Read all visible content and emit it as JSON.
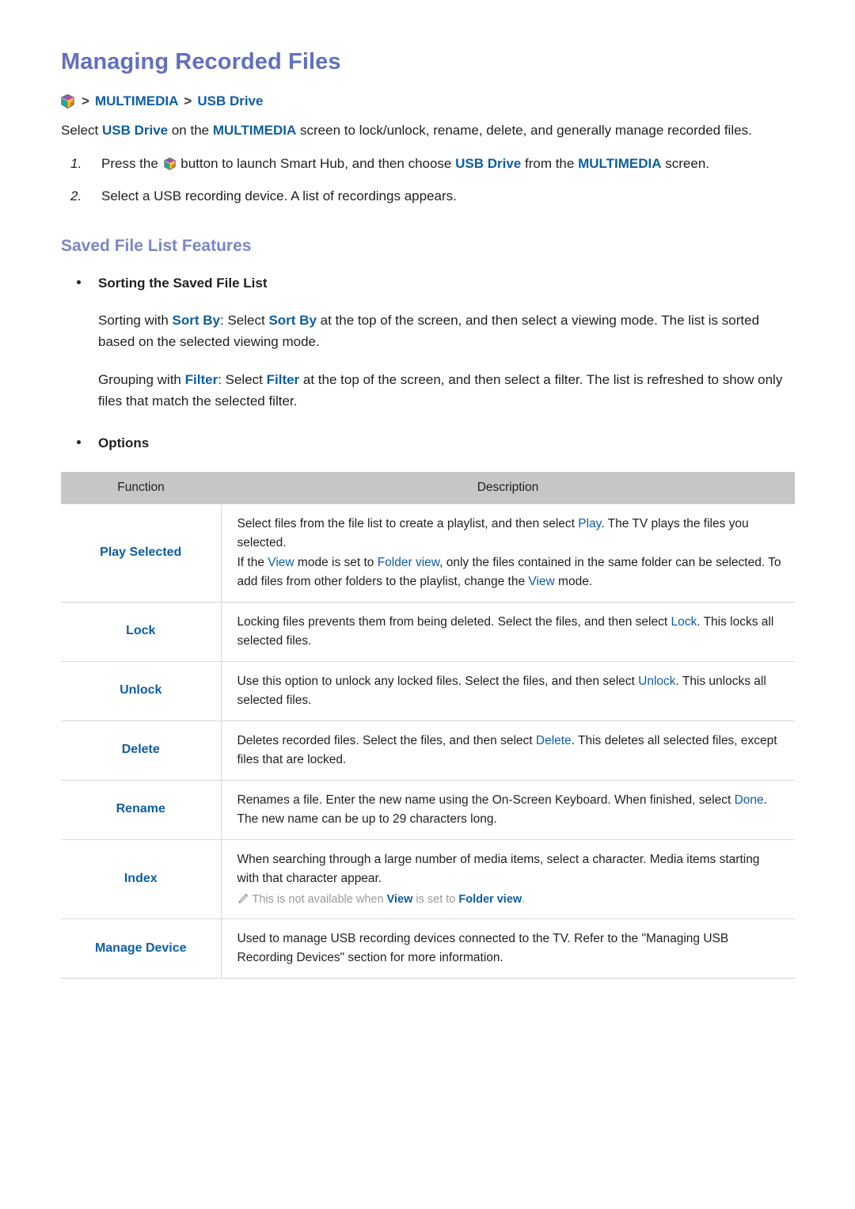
{
  "page": {
    "title": "Managing Recorded Files"
  },
  "breadcrumb": {
    "icon": "smart-hub-icon",
    "separator": ">",
    "items": [
      "MULTIMEDIA",
      "USB Drive"
    ]
  },
  "intro": {
    "prefix": "Select ",
    "link1": "USB Drive",
    "mid": " on the ",
    "link2": "MULTIMEDIA",
    "suffix": " screen to lock/unlock, rename, delete, and generally manage recorded files."
  },
  "steps": [
    {
      "num": "1.",
      "part1": "Press the ",
      "icon": "smart-hub-icon",
      "part2": " button to launch Smart Hub, and then choose ",
      "link1": "USB Drive",
      "part3": " from the ",
      "link2": "MULTIMEDIA",
      "part4": " screen."
    },
    {
      "num": "2.",
      "part1": "Select a USB recording device. A list of recordings appears.",
      "icon": "",
      "part2": "",
      "link1": "",
      "part3": "",
      "link2": "",
      "part4": ""
    }
  ],
  "section": {
    "title": "Saved File List Features",
    "bullet1": {
      "label": "Sorting the Saved File List",
      "para1": {
        "a": "Sorting with ",
        "link1": "Sort By",
        "b": ": Select ",
        "link2": "Sort By",
        "c": " at the top of the screen, and then select a viewing mode. The list is sorted based on the selected viewing mode."
      },
      "para2": {
        "a": "Grouping with ",
        "link1": "Filter",
        "b": ": Select ",
        "link2": "Filter",
        "c": " at the top of the screen, and then select a filter. The list is refreshed to show only files that match the selected filter."
      }
    },
    "bullet2": {
      "label": "Options"
    }
  },
  "table": {
    "headers": {
      "function": "Function",
      "description": "Description"
    },
    "rows": [
      {
        "function": "Play Selected",
        "line1": {
          "a": "Select files from the file list to create a playlist, and then select ",
          "l1": "Play",
          "b": ". The TV plays the files you selected.",
          "l2": "",
          "c": "",
          "l3": "",
          "d": ""
        },
        "line2": {
          "a": "If the ",
          "l1": "View",
          "b": " mode is set to ",
          "l2": "Folder view",
          "c": ", only the files contained in the same folder can be selected. To add files from other folders to the playlist, change the ",
          "l3": "View",
          "d": " mode."
        },
        "note": null
      },
      {
        "function": "Lock",
        "line1": {
          "a": "Locking files prevents them from being deleted. Select the files, and then select ",
          "l1": "Lock",
          "b": ". This locks all selected files.",
          "l2": "",
          "c": "",
          "l3": "",
          "d": ""
        },
        "line2": null,
        "note": null
      },
      {
        "function": "Unlock",
        "line1": {
          "a": "Use this option to unlock any locked files. Select the files, and then select ",
          "l1": "Unlock",
          "b": ". This unlocks all selected files.",
          "l2": "",
          "c": "",
          "l3": "",
          "d": ""
        },
        "line2": null,
        "note": null
      },
      {
        "function": "Delete",
        "line1": {
          "a": "Deletes recorded files. Select the files, and then select ",
          "l1": "Delete",
          "b": ". This deletes all selected files, except files that are locked.",
          "l2": "",
          "c": "",
          "l3": "",
          "d": ""
        },
        "line2": null,
        "note": null
      },
      {
        "function": "Rename",
        "line1": {
          "a": "Renames a file. Enter the new name using the On-Screen Keyboard. When finished, select ",
          "l1": "Done",
          "b": ". The new name can be up to 29 characters long.",
          "l2": "",
          "c": "",
          "l3": "",
          "d": ""
        },
        "line2": null,
        "note": null
      },
      {
        "function": "Index",
        "line1": {
          "a": "When searching through a large number of media items, select a character. Media items starting with that character appear.",
          "l1": "",
          "b": "",
          "l2": "",
          "c": "",
          "l3": "",
          "d": ""
        },
        "line2": null,
        "note": {
          "icon": "pencil-icon",
          "a": "This is not available when ",
          "l1": "View",
          "b": " is set to ",
          "l2": "Folder view",
          "c": "."
        }
      },
      {
        "function": "Manage Device",
        "line1": {
          "a": "Used to manage USB recording devices connected to the TV. Refer to the \"Managing USB Recording Devices\" section for more information.",
          "l1": "",
          "b": "",
          "l2": "",
          "c": "",
          "l3": "",
          "d": ""
        },
        "line2": null,
        "note": null
      }
    ]
  },
  "colors": {
    "title_purple": "#6370bd",
    "section_purple": "#7b86c9",
    "link_blue": "#0d5ea6",
    "header_gray": "#c6c6c6",
    "note_gray": "#999999",
    "body_text": "#231f20"
  }
}
